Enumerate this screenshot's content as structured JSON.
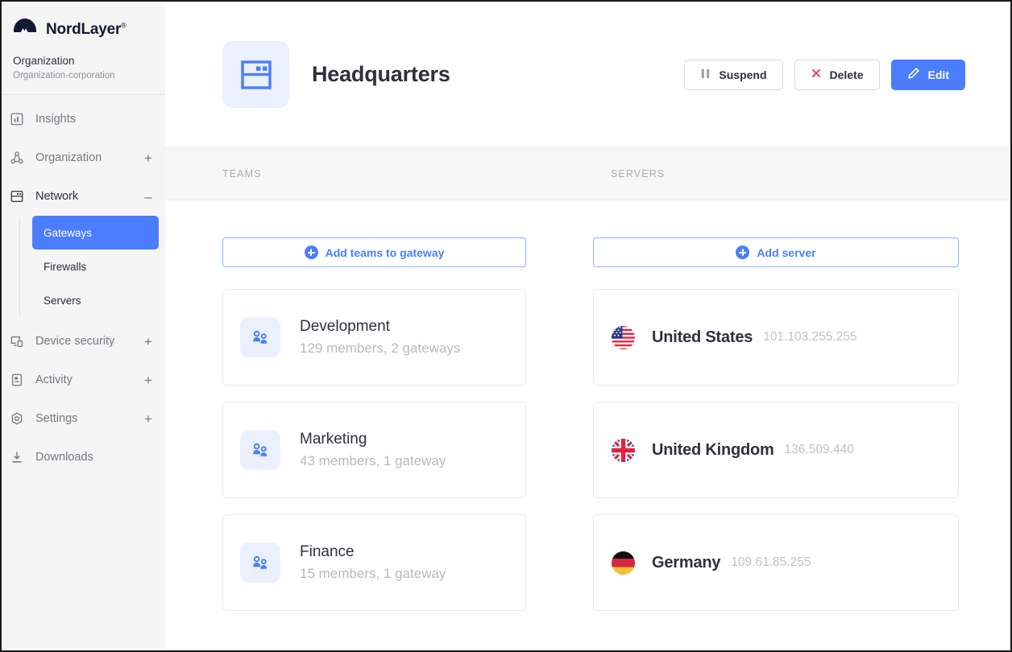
{
  "brand": {
    "name": "NordLayer",
    "registered_mark": "®",
    "logo_icon": "nordlayer-mountain-logo"
  },
  "organization": {
    "title": "Organization",
    "subtitle": "Organization-corporation"
  },
  "sidebar": {
    "items": [
      {
        "label": "Insights",
        "icon": "insights-chart-icon",
        "toggle": "",
        "active": false
      },
      {
        "label": "Organization",
        "icon": "organization-nodes-icon",
        "toggle": "+",
        "active": false
      },
      {
        "label": "Network",
        "icon": "network-server-icon",
        "toggle": "–",
        "active": true
      },
      {
        "label": "Device security",
        "icon": "device-security-icon",
        "toggle": "+",
        "active": false
      },
      {
        "label": "Activity",
        "icon": "activity-document-icon",
        "toggle": "+",
        "active": false
      },
      {
        "label": "Settings",
        "icon": "settings-gear-icon",
        "toggle": "+",
        "active": false
      },
      {
        "label": "Downloads",
        "icon": "downloads-arrow-icon",
        "toggle": "",
        "active": false
      }
    ],
    "network_submenu": [
      {
        "label": "Gateways",
        "active": true
      },
      {
        "label": "Firewalls",
        "active": false
      },
      {
        "label": "Servers",
        "active": false
      }
    ]
  },
  "header": {
    "icon": "gateway-rack-icon",
    "title": "Headquarters",
    "buttons": [
      {
        "label": "Suspend",
        "icon": "pause-icon",
        "style": "outline"
      },
      {
        "label": "Delete",
        "icon": "close-x-icon",
        "style": "outline"
      },
      {
        "label": "Edit",
        "icon": "pencil-icon",
        "style": "primary"
      }
    ]
  },
  "columns": {
    "teams_header": "TEAMS",
    "servers_header": "SERVERS"
  },
  "teams_panel": {
    "add_button": {
      "label": "Add teams to gateway",
      "icon": "plus-circle-icon"
    },
    "cards": [
      {
        "icon": "team-people-icon",
        "name": "Development",
        "meta": "129 members, 2 gateways"
      },
      {
        "icon": "team-people-icon",
        "name": "Marketing",
        "meta": "43 members, 1 gateway"
      },
      {
        "icon": "team-people-icon",
        "name": "Finance",
        "meta": "15 members, 1 gateway"
      }
    ]
  },
  "servers_panel": {
    "add_button": {
      "label": "Add server",
      "icon": "plus-circle-icon"
    },
    "cards": [
      {
        "flag": "flag-united-states-icon",
        "name": "United States",
        "ip": "101.103.255.255"
      },
      {
        "flag": "flag-united-kingdom-icon",
        "name": "United Kingdom",
        "ip": "136.509.440"
      },
      {
        "flag": "flag-germany-icon",
        "name": "Germany",
        "ip": "109.61.85.255"
      }
    ]
  },
  "colors": {
    "accent_blue": "#4a7dff",
    "accent_blue_light": "#eaf0fe",
    "sidebar_bg": "#f5f5f6",
    "band_bg": "#f7f7f8",
    "text_dark": "#2d313c",
    "text_muted": "#b6b9c0",
    "delete_red": "#f04050"
  }
}
